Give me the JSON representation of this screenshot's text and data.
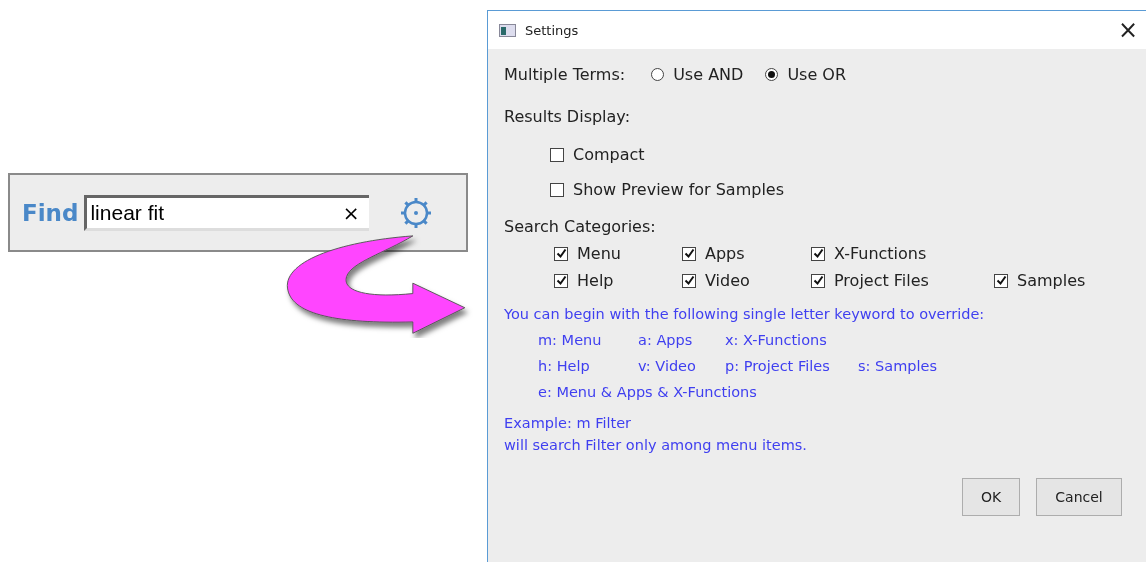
{
  "find_bar": {
    "label": "Find",
    "search": {
      "value": "linear fit"
    },
    "clear": "×"
  },
  "dialog": {
    "title": "Settings",
    "close": "×",
    "multiple_terms": {
      "label": "Multiple Terms:",
      "options": [
        {
          "label": "Use AND",
          "selected": false
        },
        {
          "label": "Use OR",
          "selected": true
        }
      ]
    },
    "results_display": {
      "label": "Results Display:",
      "options": [
        {
          "label": "Compact",
          "checked": false
        },
        {
          "label": "Show Preview for Samples",
          "checked": false
        }
      ]
    },
    "search_categories": {
      "label": "Search Categories:",
      "rows": [
        [
          {
            "label": "Menu",
            "checked": true
          },
          {
            "label": "Apps",
            "checked": true
          },
          {
            "label": "X-Functions",
            "checked": true
          }
        ],
        [
          {
            "label": "Help",
            "checked": true
          },
          {
            "label": "Video",
            "checked": true
          },
          {
            "label": "Project Files",
            "checked": true
          },
          {
            "label": "Samples",
            "checked": true
          }
        ]
      ]
    },
    "hint": "You can begin with the following single letter keyword to override:",
    "keywords": [
      [
        "m: Menu",
        "a: Apps",
        "x: X-Functions"
      ],
      [
        "h: Help",
        "v: Video",
        "p: Project Files",
        "s: Samples"
      ],
      [
        "e: Menu & Apps & X-Functions"
      ]
    ],
    "example": [
      "Example: m Filter",
      "will search Filter only among menu items."
    ],
    "buttons": [
      "OK",
      "Cancel"
    ]
  }
}
